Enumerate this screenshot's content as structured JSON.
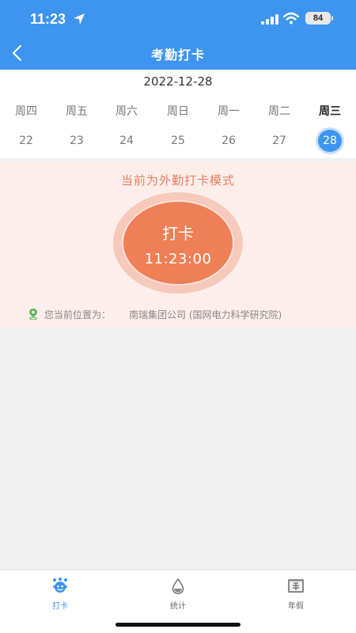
{
  "status": {
    "time": "11:23",
    "battery": "84"
  },
  "nav": {
    "title": "考勤打卡",
    "back_icon": "chevron-left-icon"
  },
  "calendar": {
    "date": "2022-12-28",
    "weekdays": [
      "周四",
      "周五",
      "周六",
      "周日",
      "周一",
      "周二",
      "周三"
    ],
    "days": [
      "22",
      "23",
      "24",
      "25",
      "26",
      "27",
      "28"
    ],
    "selected_day": "28"
  },
  "checkin": {
    "mode_text": "当前为外勤打卡模式",
    "button_label": "打卡",
    "button_time": "11:23:00",
    "location_label": "您当前位置为：",
    "location_value": "南瑞集团公司 (国网电力科学研究院)"
  },
  "tabs": [
    {
      "label": "打卡",
      "icon": "checkin-icon",
      "active": true
    },
    {
      "label": "统计",
      "icon": "stats-icon",
      "active": false
    },
    {
      "label": "年假",
      "icon": "annual-leave-icon",
      "active": false
    }
  ],
  "colors": {
    "primary": "#3d95f0",
    "punch": "#ee7f56",
    "panel_bg": "#fdeeeb",
    "mode_text": "#e8805f"
  }
}
